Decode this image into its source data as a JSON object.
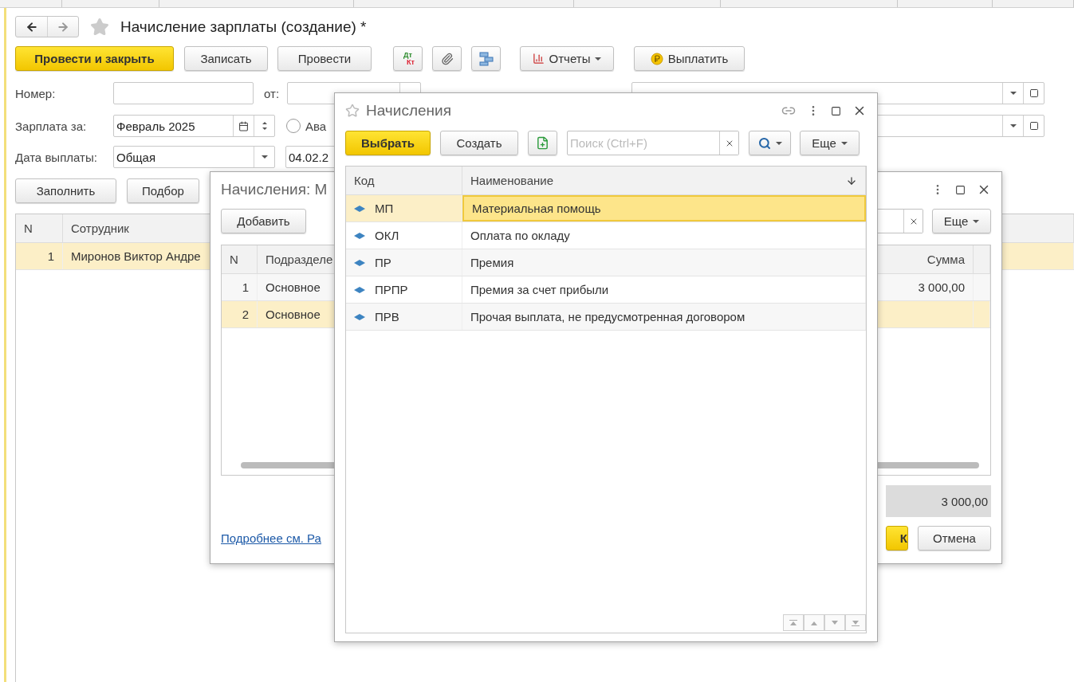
{
  "main": {
    "title": "Начисление зарплаты (создание) *",
    "toolbar": {
      "post_close": "Провести и закрыть",
      "save": "Записать",
      "post": "Провести",
      "dt": "Дт",
      "kt": "Кт",
      "reports": "Отчеты",
      "pay": "Выплатить"
    },
    "number": {
      "label": "Номер:",
      "date_label": "от:"
    },
    "salary_for": {
      "label": "Зарплата за:",
      "value": "Февраль 2025"
    },
    "advance": {
      "label": "Ава",
      "selected": false
    },
    "pay_date": {
      "label": "Дата выплаты:",
      "value": "Общая",
      "date": "04.02.2"
    },
    "buttons": [
      "Заполнить",
      "Подбор"
    ],
    "table": {
      "columns": [
        "N",
        "Сотрудник"
      ],
      "rows": [
        {
          "n": "1",
          "employee": "Миронов Виктор Андре",
          "selected": true
        }
      ]
    }
  },
  "accruals_form": {
    "title": "Начисления: М",
    "add": "Добавить",
    "more": "Еще",
    "columns": [
      "N",
      "Подразделе",
      "Сумма"
    ],
    "rows": [
      {
        "n": "1",
        "department": "Основное",
        "sum": "3 000,00",
        "selected": false
      },
      {
        "n": "2",
        "department": "Основное",
        "selected": true
      }
    ],
    "total": "3 000,00",
    "link": "Подробнее см. Ра",
    "ok": "К",
    "cancel": "Отмена"
  },
  "picker": {
    "title": "Начисления",
    "select": "Выбрать",
    "create": "Создать",
    "search": {
      "placeholder": "Поиск (Ctrl+F)"
    },
    "more": "Еще",
    "columns": [
      "Код",
      "Наименование"
    ],
    "rows": [
      {
        "code": "МП",
        "name": "Материальная помощь",
        "selected": true
      },
      {
        "code": "ОКЛ",
        "name": "Оплата по окладу",
        "selected": false
      },
      {
        "code": "ПР",
        "name": "Премия",
        "selected": false
      },
      {
        "code": "ПРПР",
        "name": "Премия за счет прибыли",
        "selected": false
      },
      {
        "code": "ПРВ",
        "name": "Прочая выплата, не предусмотренная договором",
        "selected": false
      }
    ]
  }
}
